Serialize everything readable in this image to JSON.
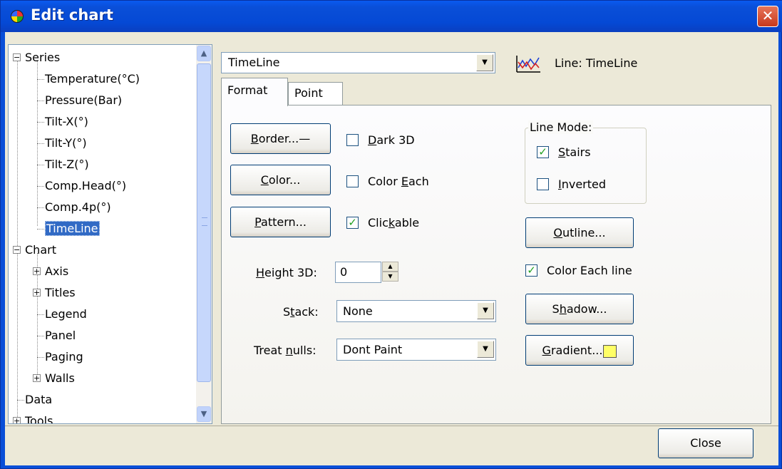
{
  "window": {
    "title": "Edit chart",
    "close_glyph": "✕"
  },
  "tree": {
    "items": [
      {
        "label": "Series",
        "level": 0,
        "expander": "−"
      },
      {
        "label": "Temperature(°C)",
        "level": 1
      },
      {
        "label": "Pressure(Bar)",
        "level": 1
      },
      {
        "label": "Tilt-X(°)",
        "level": 1
      },
      {
        "label": "Tilt-Y(°)",
        "level": 1
      },
      {
        "label": "Tilt-Z(°)",
        "level": 1
      },
      {
        "label": "Comp.Head(°)",
        "level": 1
      },
      {
        "label": "Comp.4p(°)",
        "level": 1
      },
      {
        "label": "TimeLine",
        "level": 1,
        "selected": true
      },
      {
        "label": "Chart",
        "level": 0,
        "expander": "−"
      },
      {
        "label": "Axis",
        "level": 1,
        "expander": "+"
      },
      {
        "label": "Titles",
        "level": 1,
        "expander": "+"
      },
      {
        "label": "Legend",
        "level": 1
      },
      {
        "label": "Panel",
        "level": 1
      },
      {
        "label": "Paging",
        "level": 1
      },
      {
        "label": "Walls",
        "level": 1,
        "expander": "+"
      },
      {
        "label": "Data",
        "level": 0
      },
      {
        "label": "Tools",
        "level": 0,
        "expander": "+"
      }
    ]
  },
  "series_selector": {
    "value": "TimeLine",
    "type_label": "Line: TimeLine",
    "icon": "line-chart-icon"
  },
  "tabs": [
    {
      "label": "Format",
      "active": true
    },
    {
      "label": "Point",
      "active": false
    }
  ],
  "format": {
    "border_button": {
      "underline": "B",
      "rest": "order...—"
    },
    "color_button": {
      "underline": "C",
      "rest": "olor..."
    },
    "pattern_button": {
      "underline": "P",
      "rest": "attern..."
    },
    "dark3d": {
      "pre": "",
      "underline": "D",
      "post": "ark 3D",
      "checked": false
    },
    "color_each": {
      "pre": "Color ",
      "underline": "E",
      "post": "ach",
      "checked": false
    },
    "clickable": {
      "pre": "Clic",
      "underline": "k",
      "post": "able",
      "checked": true
    },
    "height3d": {
      "pre": "",
      "underline": "H",
      "post": "eight 3D:",
      "value": "0"
    },
    "stack": {
      "pre": "S",
      "underline": "t",
      "post": "ack:",
      "value": "None"
    },
    "treat_nulls": {
      "pre": "Treat ",
      "underline": "n",
      "post": "ulls:",
      "value": "Dont Paint"
    },
    "line_mode": {
      "legend": "Line Mode:",
      "stairs": {
        "underline": "S",
        "post": "tairs",
        "checked": true
      },
      "inverted": {
        "underline": "I",
        "post": "nverted",
        "checked": false
      }
    },
    "outline_button": {
      "underline": "O",
      "rest": "utline..."
    },
    "color_each_line": {
      "label": "Color Each line",
      "checked": true
    },
    "shadow_button": {
      "pre": "S",
      "underline": "h",
      "rest": "adow..."
    },
    "gradient_button": {
      "underline": "G",
      "rest": "radient...",
      "swatch_color": "#FFFF66"
    }
  },
  "footer": {
    "close_label": "Close"
  },
  "glyphs": {
    "check": "✓",
    "down": "▼",
    "up": "▲",
    "spin_up": "▲",
    "spin_down": "▼"
  }
}
